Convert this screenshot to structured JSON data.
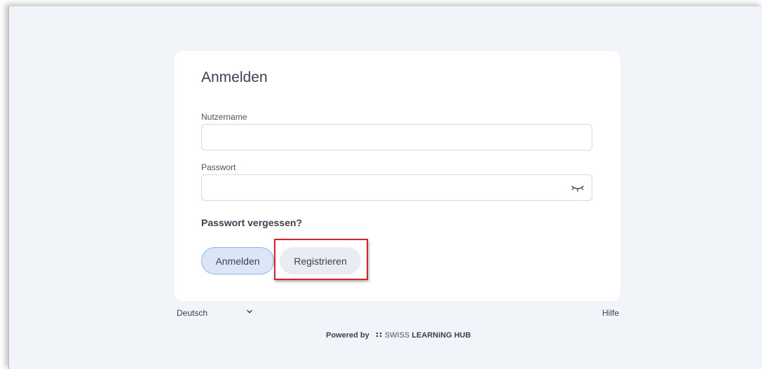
{
  "login": {
    "title": "Anmelden",
    "username_label": "Nutzername",
    "username_value": "",
    "password_label": "Passwort",
    "password_value": "",
    "forgot_password": "Passwort vergessen?",
    "login_button": "Anmelden",
    "register_button": "Registrieren"
  },
  "footer": {
    "language": "Deutsch",
    "help": "Hilfe",
    "powered_by": "Powered by",
    "brand_light": "SWISS",
    "brand_bold": "LEARNiNG HUB"
  },
  "icons": {
    "password_toggle": "eye-closed-icon",
    "language_dropdown": "chevron-down-icon",
    "brand_logo": "dots-logo-icon"
  },
  "colors": {
    "background": "#f1f4f8",
    "card": "#ffffff",
    "primary_button": "#dbe7f9",
    "primary_button_border": "#8db3e6",
    "secondary_button": "#e9ecf1",
    "highlight": "#d6202a"
  }
}
